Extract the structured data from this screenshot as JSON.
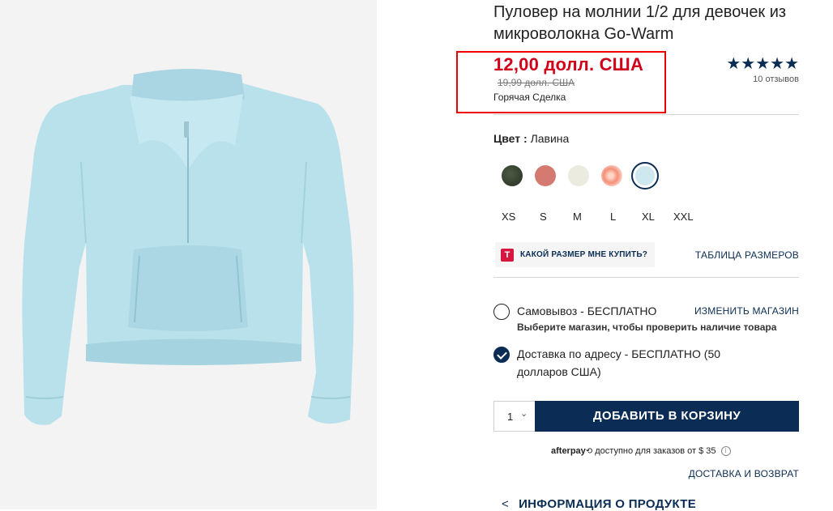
{
  "product": {
    "title": "Пуловер на молнии 1/2 для девочек из микроволокна Go-Warm",
    "price_now": "12,00 долл. США",
    "price_was": "19,99 долл. США",
    "deal_label": "Горячая Сделка",
    "rating_stars": "★★★★★",
    "reviews": "10 отзывов"
  },
  "color": {
    "label": "Цвет :",
    "value": "Лавина",
    "swatches": [
      {
        "name": "dark-green",
        "color": "#2f3a2c"
      },
      {
        "name": "rose",
        "color": "#d47a70"
      },
      {
        "name": "cream",
        "color": "#ecebe0"
      },
      {
        "name": "tie-dye",
        "color": "#f6a08a"
      },
      {
        "name": "light-blue",
        "color": "#cfe7ee",
        "selected": true
      }
    ]
  },
  "sizes": [
    "XS",
    "S",
    "M",
    "L",
    "XL",
    "XXL"
  ],
  "size_help": {
    "icon_letter": "T",
    "label": "КАКОЙ РАЗМЕР МНЕ КУПИТЬ?",
    "chart_link": "ТАБЛИЦА РАЗМЕРОВ"
  },
  "fulfillment": {
    "pickup_label": "Самовывоз - БЕСПЛАТНО",
    "pickup_sub": "Выберите магазин, чтобы проверить наличие товара",
    "change_store": "ИЗМЕНИТЬ МАГАЗИН",
    "delivery_line1": "Доставка по адресу - БЕСПЛАТНО (50",
    "delivery_line2": "долларов США)"
  },
  "cart": {
    "qty": "1",
    "qty_chevron": "⌄",
    "add_label": "ДОБАВИТЬ В КОРЗИНУ"
  },
  "afterpay": {
    "brand": "afterpay",
    "text": "доступно для заказов от $ 35",
    "info": "i"
  },
  "links": {
    "shipping": "ДОСТАВКА И ВОЗВРАТ",
    "product_info": "ИНФОРМАЦИЯ О ПРОДУКТЕ",
    "product_info_chevron": "<"
  },
  "colors": {
    "navy": "#0b2d55",
    "sale_red": "#d0021b",
    "highlight_box": "#e00000"
  }
}
